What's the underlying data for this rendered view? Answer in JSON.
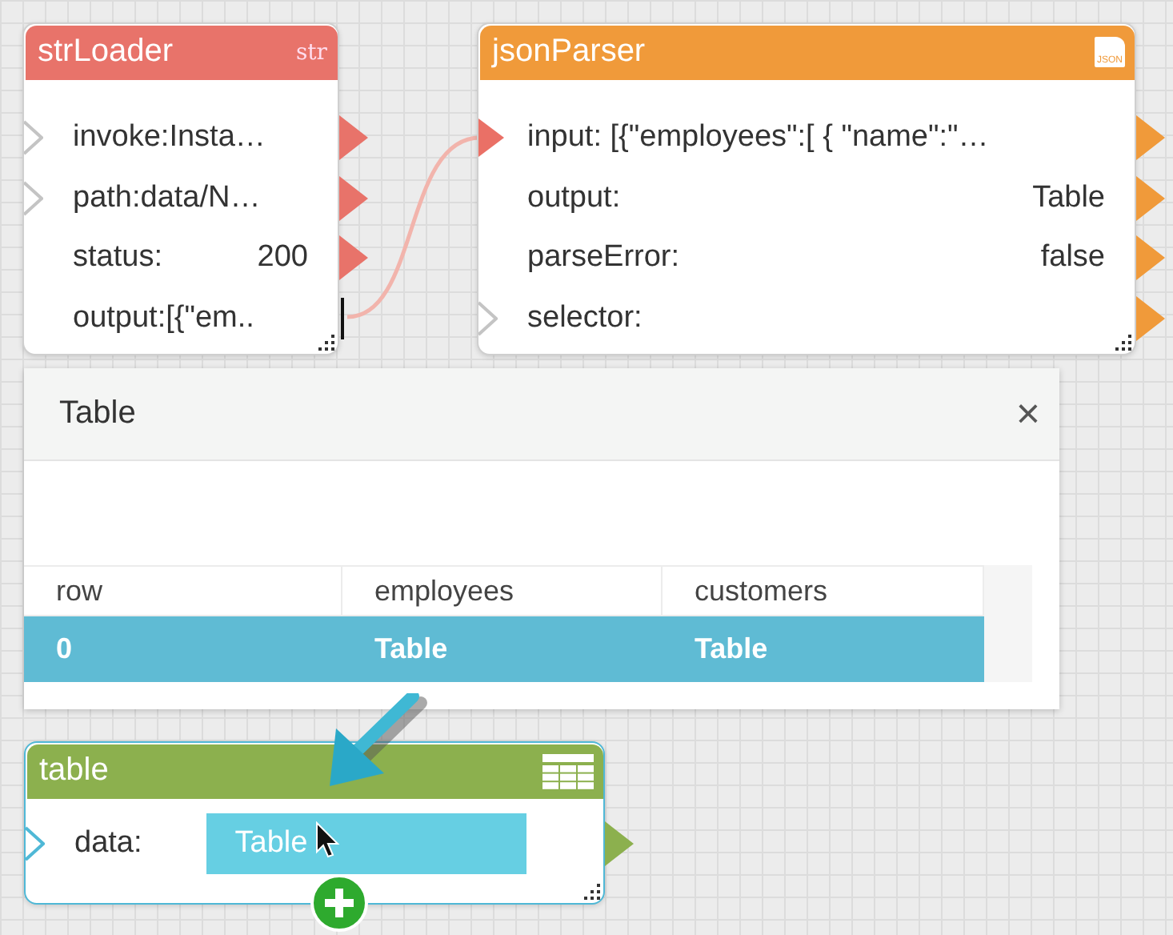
{
  "nodes": [
    {
      "title": "strLoader",
      "color": "#e8736a",
      "selected": false,
      "icon": {
        "kind": "text",
        "text": "str"
      },
      "rows": [
        {
          "label": "invoke:Insta…",
          "input_open": true,
          "input_connected": false,
          "output": true
        },
        {
          "label": "path:data/N…",
          "input_open": true,
          "input_connected": false,
          "output": true
        },
        {
          "label": "status:",
          "value": "200",
          "input_open": false,
          "input_connected": false,
          "output": true
        },
        {
          "label": "output:[{\"em..",
          "input_open": false,
          "input_connected": false,
          "output": false,
          "editing": true
        }
      ]
    },
    {
      "title": "jsonParser",
      "color": "#f09a3a",
      "selected": false,
      "icon": {
        "kind": "document",
        "text": "JSON"
      },
      "rows": [
        {
          "label": "input: [{\"employees\":[ { \"name\":\"…",
          "input_open": false,
          "input_connected": true,
          "output": true
        },
        {
          "label": "output:",
          "value": "Table",
          "input_open": false,
          "input_connected": false,
          "output": true
        },
        {
          "label": "parseError:",
          "value": "false",
          "input_open": false,
          "input_connected": false,
          "output": true
        },
        {
          "label": "selector:",
          "input_open": true,
          "input_connected": false,
          "output": true
        }
      ]
    },
    {
      "title": "table",
      "color": "#8cb04e",
      "selected": true,
      "icon": {
        "kind": "grid"
      },
      "rows": [
        {
          "label": "data:",
          "field": "Table",
          "input_open": true,
          "input_connected": false,
          "output": true
        }
      ]
    }
  ],
  "popup": {
    "title": "Table",
    "close": "×",
    "columns": [
      "row",
      "employees",
      "customers"
    ],
    "rows": [
      {
        "selected": true,
        "cells": [
          "0",
          "Table",
          "Table"
        ]
      }
    ]
  }
}
